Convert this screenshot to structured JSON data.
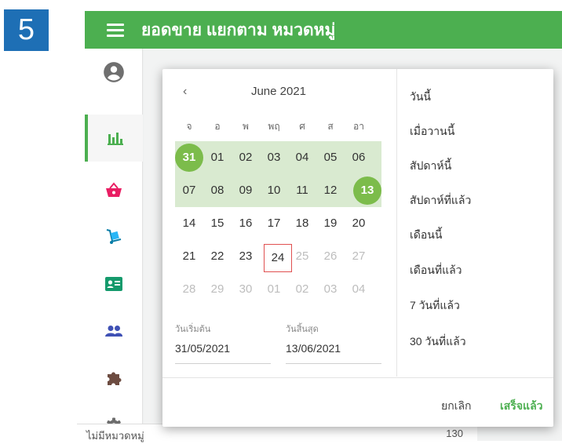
{
  "step_number": "5",
  "header": {
    "title": "ยอดขาย แยกตาม หมวดหมู่"
  },
  "sidebar": {
    "items": [
      {
        "icon": "account-circle-icon"
      },
      {
        "icon": "bar-chart-icon",
        "active": true
      },
      {
        "icon": "shopping-basket-icon"
      },
      {
        "icon": "dolly-icon"
      },
      {
        "icon": "contact-card-icon"
      },
      {
        "icon": "people-icon"
      },
      {
        "icon": "puzzle-icon"
      },
      {
        "icon": "settings-icon"
      }
    ]
  },
  "background_table": {
    "row_label": "ไม่มีหมวดหมู่",
    "row_value": "130"
  },
  "calendar": {
    "prev_symbol": "‹",
    "month_title": "June 2021",
    "weekdays": [
      "จ",
      "อ",
      "พ",
      "พฤ",
      "ศ",
      "ส",
      "อา"
    ],
    "weeks": [
      [
        "31",
        "01",
        "02",
        "03",
        "04",
        "05",
        "06"
      ],
      [
        "07",
        "08",
        "09",
        "10",
        "11",
        "12",
        "13"
      ],
      [
        "14",
        "15",
        "16",
        "17",
        "18",
        "19",
        "20"
      ],
      [
        "21",
        "22",
        "23",
        "24",
        "25",
        "26",
        "27"
      ],
      [
        "28",
        "29",
        "30",
        "01",
        "02",
        "03",
        "04"
      ]
    ],
    "start_label": "วันเริ่มต้น",
    "start_value": "31/05/2021",
    "end_label": "วันสิ้นสุด",
    "end_value": "13/06/2021"
  },
  "presets": [
    "วันนี้",
    "เมื่อวานนี้",
    "สัปดาห์นี้",
    "สัปดาห์ที่แล้ว",
    "เดือนนี้",
    "เดือนที่แล้ว",
    "7 วันที่แล้ว",
    "30 วันที่แล้ว"
  ],
  "actions": {
    "cancel": "ยกเลิก",
    "done": "เสร็จแล้ว"
  },
  "colors": {
    "primary": "#4caf50",
    "range": "#d9ead0",
    "endpoint": "#7cbc4b",
    "today_border": "#e05050",
    "badge": "#1e6fb5"
  }
}
